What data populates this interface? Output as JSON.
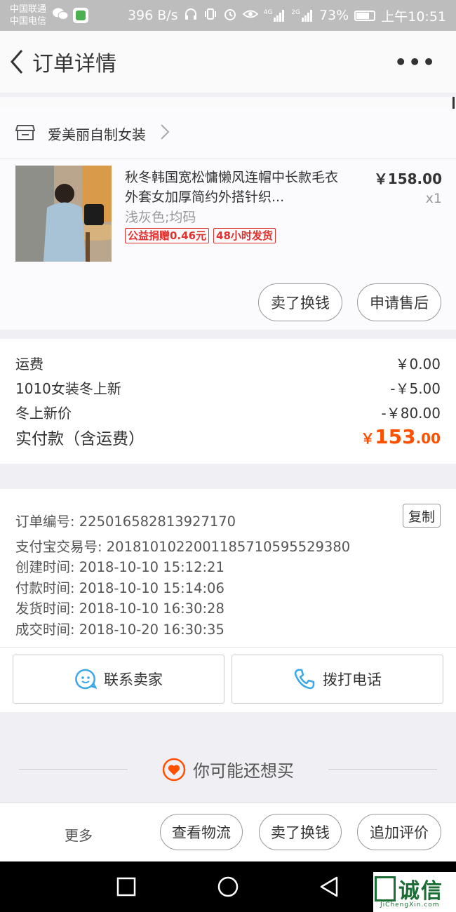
{
  "status_bar": {
    "carrier1": "中国联通",
    "carrier2": "中国电信",
    "speed": "396 B/s",
    "net_4g": "4G",
    "net_2g": "2G",
    "battery": "73%",
    "time": "上午10:51"
  },
  "nav": {
    "title": "订单详情",
    "more": "•••"
  },
  "shop": {
    "name": "爱美丽自制女装"
  },
  "item": {
    "title": "秋冬韩国宽松慵懒风连帽中长款毛衣外套女加厚简约外搭针织...",
    "sku": "浅灰色;均码",
    "tags": [
      "公益捐赠0.46元",
      "48小时发货"
    ],
    "price": "￥158.00",
    "qty": "x1",
    "actions": [
      "卖了换钱",
      "申请售后"
    ]
  },
  "fees": {
    "rows": [
      {
        "label": "运费",
        "value": "￥0.00"
      },
      {
        "label": "1010女装冬上新",
        "value": "-￥5.00"
      },
      {
        "label": "冬上新价",
        "value": "-￥80.00"
      }
    ],
    "total_label": "实付款（含运费）",
    "total_currency": "￥",
    "total_int": "153",
    "total_dec": ".00"
  },
  "order_info": {
    "order_no": "订单编号: 225016582813927170",
    "copy": "复制",
    "alipay_no": "支付宝交易号: 2018101022001185710595529380",
    "created": "创建时间: 2018-10-10 15:12:21",
    "paid": "付款时间: 2018-10-10 15:14:06",
    "shipped": "发货时间: 2018-10-10 16:30:28",
    "completed": "成交时间: 2018-10-20 16:30:35",
    "contact_seller": "联系卖家",
    "call_phone": "拨打电话"
  },
  "recommend": {
    "title": "你可能还想买"
  },
  "bottom_bar": {
    "more": "更多",
    "buttons": [
      "查看物流",
      "卖了换钱",
      "追加评价"
    ]
  },
  "watermark": {
    "text": "诚信",
    "sub": "JiChengXin.com"
  },
  "colors": {
    "accent": "#ff5000",
    "tag_red": "#e2322e",
    "contact_blue": "#3aa7e8"
  }
}
